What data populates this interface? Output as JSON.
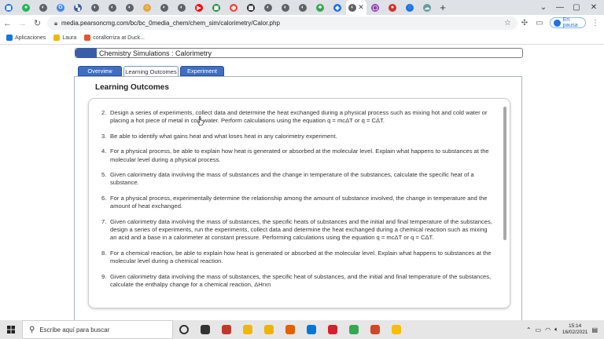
{
  "browser": {
    "tabs": [
      {
        "icon": "calendar-icon",
        "color": "#1a73e8",
        "glyph": "▦"
      },
      {
        "icon": "spotify-icon",
        "color": "#1db954",
        "glyph": "●"
      },
      {
        "icon": "generic-page-icon",
        "color": "#5f6368",
        "glyph": "◐"
      },
      {
        "icon": "google-icon",
        "color": "#4285f4",
        "glyph": "G"
      },
      {
        "icon": "bookmark-icon",
        "color": "#3a5da8",
        "glyph": "▚"
      },
      {
        "icon": "generic-page-icon",
        "color": "#5f6368",
        "glyph": "◐"
      },
      {
        "icon": "generic-page-icon",
        "color": "#5f6368",
        "glyph": "◐"
      },
      {
        "icon": "generic-page-icon",
        "color": "#5f6368",
        "glyph": "◐"
      },
      {
        "icon": "home-icon",
        "color": "#e8a33a",
        "glyph": "⌂"
      },
      {
        "icon": "generic-page-icon",
        "color": "#5f6368",
        "glyph": "◐"
      },
      {
        "icon": "generic-page-icon",
        "color": "#5f6368",
        "glyph": "◐"
      },
      {
        "icon": "youtube-icon",
        "color": "#ff0000",
        "glyph": "▶"
      },
      {
        "icon": "classroom-icon",
        "color": "#1e8e3e",
        "glyph": "▣"
      },
      {
        "icon": "chrome-icon",
        "color": "#ea4335",
        "glyph": "◉"
      },
      {
        "icon": "media-icon",
        "color": "#202124",
        "glyph": "▩"
      },
      {
        "icon": "generic-page-icon",
        "color": "#5f6368",
        "glyph": "◐"
      },
      {
        "icon": "generic-page-icon",
        "color": "#5f6368",
        "glyph": "◐"
      },
      {
        "icon": "generic-page-icon",
        "color": "#5f6368",
        "glyph": "◐"
      },
      {
        "icon": "game-icon",
        "color": "#34a853",
        "glyph": "♣"
      },
      {
        "icon": "drop-icon",
        "color": "#1a73e8",
        "glyph": "◆"
      }
    ],
    "active_tab": {
      "icon": "pearson-icon",
      "color": "#5f6368",
      "glyph": "◐",
      "close_glyph": "✕"
    },
    "tabs_after": [
      {
        "icon": "purple-app-icon",
        "color": "#8e44ad",
        "glyph": "▢"
      },
      {
        "icon": "record-icon",
        "color": "#d93025",
        "glyph": "●"
      },
      {
        "icon": "info-icon",
        "color": "#1a73e8",
        "glyph": "◌"
      },
      {
        "icon": "cloud-icon",
        "color": "#5f9ea0",
        "glyph": "☁"
      }
    ],
    "new_tab": "+",
    "url": "media.pearsoncmg.com/bc/bc_0media_chem/chem_sim/calorimetry/Calor.php",
    "profile_label": "En pausa",
    "bookmarks": [
      {
        "label": "Aplicaciones",
        "icon": "apps-grid-icon",
        "color": "#1a73e8"
      },
      {
        "label": "Laura",
        "icon": "folder-icon",
        "color": "#f2b705"
      },
      {
        "label": "corallorriza at Duck...",
        "icon": "duckduckgo-icon",
        "color": "#de5833"
      }
    ]
  },
  "simulation": {
    "header_title": "Chemistry Simulations : Calorimetry",
    "tabs": [
      "Overview",
      "Learning Outcomes",
      "Experiment"
    ],
    "active_tab_index": 1,
    "section_title": "Learning Outcomes",
    "outcomes": [
      {
        "num": "2.",
        "text": "Design a series of experiments, collect data and determine the heat exchanged during a physical process such as mixing hot and cold water or placing a hot piece of metal in cool water. Perform calculations using the equation q = mcΔT or q = CΔT."
      },
      {
        "num": "3.",
        "text": "Be able to identify what gains heat and what loses heat in any calorimetry experiment."
      },
      {
        "num": "4.",
        "text": "For a physical process, be able to explain how heat is generated or absorbed at the molecular level. Explain what happens to substances at the molecular level during a physical process."
      },
      {
        "num": "5.",
        "text": "Given calorimetry data involving the mass of substances and the change in temperature of the substances, calculate the specific heat of a substance."
      },
      {
        "num": "6.",
        "text": "For a physical process, experimentally determine the relationship among the amount of substance involved, the change in temperature and the amount of heat exchanged."
      },
      {
        "num": "7.",
        "text": "Given calorimetry data involving the mass of substances, the specific heats of substances and the initial and final temperature of the substances, design a series of experiments, run the experiments, collect data and determine the heat exchanged during a chemical reaction such as mixing an acid and a base in a calorimeter at constant pressure. Performing calculations using the equation q = mcΔT or q = CΔT."
      },
      {
        "num": "8.",
        "text": "For a chemical reaction, be able to explain how heat is generated or absorbed at the molecular level. Explain what happens to substances at the molecular level during a chemical reaction."
      },
      {
        "num": "9.",
        "text": "Given calorimetry data involving the mass of substances, the specific heat of substances, and the initial and final temperature of the substances, calculate the enthalpy change for a chemical reaction, ΔHrxn"
      }
    ]
  },
  "taskbar": {
    "search_placeholder": "Escribe aquí para buscar",
    "apps": [
      {
        "icon": "cortana-icon",
        "color": "#333333"
      },
      {
        "icon": "task-view-icon",
        "color": "#333333"
      },
      {
        "icon": "power-app-icon",
        "color": "#c0392b"
      },
      {
        "icon": "file-explorer-icon",
        "color": "#f2b705"
      },
      {
        "icon": "settings-app-icon",
        "color": "#f0b400"
      },
      {
        "icon": "firefox-icon",
        "color": "#e66000"
      },
      {
        "icon": "edge-icon",
        "color": "#0078d7"
      },
      {
        "icon": "acrobat-icon",
        "color": "#d4202c"
      },
      {
        "icon": "chrome-taskbar-icon",
        "color": "#34a853"
      },
      {
        "icon": "powerpoint-icon",
        "color": "#d24726"
      },
      {
        "icon": "chrome-alt-icon",
        "color": "#fbbc05"
      }
    ],
    "time": "15:14",
    "date": "16/02/2021"
  }
}
